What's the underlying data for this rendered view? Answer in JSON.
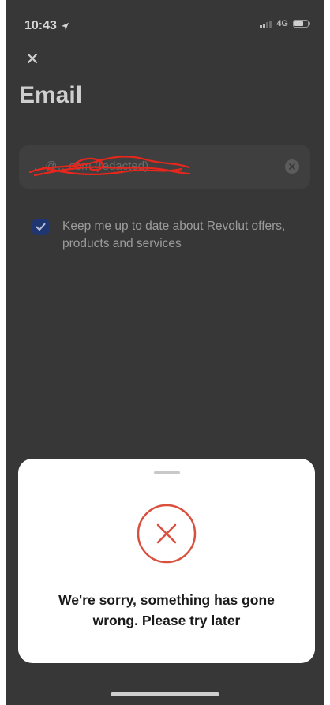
{
  "status_bar": {
    "time": "10:43",
    "network": "4G"
  },
  "header": {
    "title": "Email"
  },
  "email_field": {
    "value": "…@…com (redacted)"
  },
  "marketing_opt_in": {
    "checked": true,
    "label": "Keep me up to date about Revolut offers, products and services"
  },
  "error_sheet": {
    "message": "We're sorry, something has gone wrong. Please try later"
  },
  "icons": {
    "close": "close-icon",
    "location": "location-arrow-icon",
    "clear": "clear-circle-icon",
    "check": "checkmark-icon",
    "error": "error-circle-x-icon"
  },
  "colors": {
    "background": "#373737",
    "field": "#3f3f3f",
    "checkbox": "#203670",
    "error_red": "#d9503f",
    "sheet": "#ffffff",
    "redaction": "#e8261c"
  }
}
